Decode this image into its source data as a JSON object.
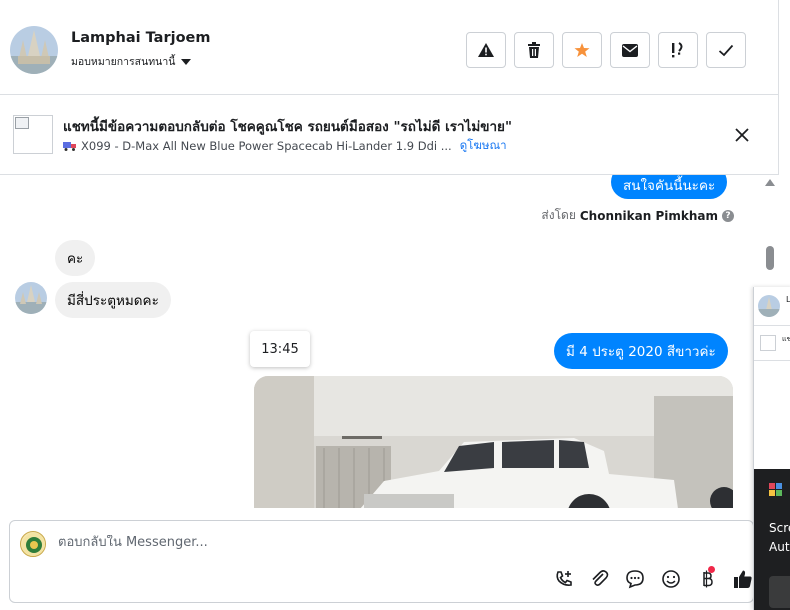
{
  "header": {
    "user_name": "Lamphai Tarjoem",
    "assign_label": "มอบหมายการสนทนานี้",
    "actions": [
      "warning-icon",
      "trash-icon",
      "star-icon",
      "envelope-icon",
      "follow-up-icon",
      "check-icon"
    ],
    "star_color": "#f7923b"
  },
  "ad": {
    "title": "แชทนี้มีข้อความตอบกลับต่อ โชคคูณโชค รถยนต์มือสอง \"รถไม่ดี เราไม่ขาย\"",
    "subtitle": "X099 - D-Max All New Blue Power Spacecab Hi-Lander 1.9 Ddi ...",
    "link_label": "ดูโฆษณา"
  },
  "messages": {
    "outgoing_1": "สนใจคันนี้นะคะ",
    "sent_by_prefix": "ส่งโดย",
    "sent_by_name": "Chonnikan Pimkham",
    "incoming_1": "คะ",
    "incoming_2": "มีสี่ประตูหมดคะ",
    "timestamp": "13:45",
    "outgoing_2": "มี 4 ประตู 2020 สีขาวค่ะ"
  },
  "composer": {
    "placeholder": "ตอบกลับใน Messenger...",
    "tools": [
      "call-add-icon",
      "paperclip-icon",
      "chat-bubble-icon",
      "emoji-icon",
      "baht-icon",
      "thumbs-up-icon"
    ]
  },
  "mini_window": {
    "name_fragment": "L",
    "ad_fragment": "แช",
    "line1": "Scre",
    "line2": "Aut"
  },
  "colors": {
    "accent": "#0084ff",
    "link": "#1877f2",
    "border": "#ccd0d5"
  }
}
